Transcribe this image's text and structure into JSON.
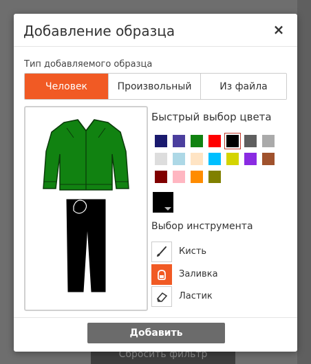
{
  "background": {
    "button_label": "Сбросить фильтр"
  },
  "dialog": {
    "title": "Добавление образца",
    "close_label": "×",
    "type_section_label": "Тип добавляемого образца",
    "type_tabs": [
      {
        "label": "Человек",
        "active": true
      },
      {
        "label": "Произвольный",
        "active": false
      },
      {
        "label": "Из файла",
        "active": false
      }
    ],
    "quick_color_title": "Быстрый выбор цвета",
    "swatches": [
      {
        "color": "#1a1a6e",
        "selected": false
      },
      {
        "color": "#4b3f9e",
        "selected": false
      },
      {
        "color": "#118211",
        "selected": false
      },
      {
        "color": "#ff0000",
        "selected": false
      },
      {
        "color": "#000000",
        "selected": true
      },
      {
        "color": "#5f5f5f",
        "selected": false
      },
      {
        "color": "#aaaaaa",
        "selected": false
      },
      {
        "color": "#dddddd",
        "selected": false
      },
      {
        "color": "#add8e6",
        "selected": false
      },
      {
        "color": "#ffe4c4",
        "selected": false
      },
      {
        "color": "#00bfff",
        "selected": false
      },
      {
        "color": "#d4d400",
        "selected": false
      },
      {
        "color": "#8a2be2",
        "selected": false
      },
      {
        "color": "#a0522d",
        "selected": false
      },
      {
        "color": "#800000",
        "selected": false
      },
      {
        "color": "#ffb6c1",
        "selected": false
      },
      {
        "color": "#ff8c00",
        "selected": false
      },
      {
        "color": "#808000",
        "selected": false
      }
    ],
    "current_color": "#000000",
    "tool_title": "Выбор инструмента",
    "tools": [
      {
        "label": "Кисть",
        "icon": "brush-icon",
        "active": false
      },
      {
        "label": "Заливка",
        "icon": "bucket-icon",
        "active": true
      },
      {
        "label": "Ластик",
        "icon": "eraser-icon",
        "active": false
      }
    ],
    "add_button_label": "Добавить",
    "preview": {
      "jacket_color": "#118211",
      "pants_color": "#000000"
    }
  }
}
